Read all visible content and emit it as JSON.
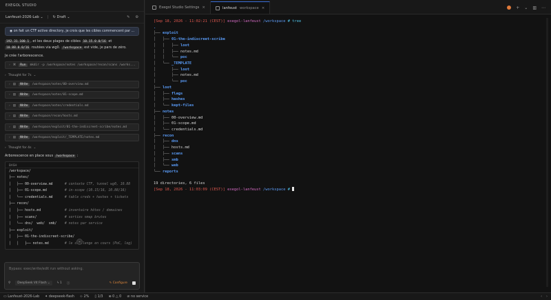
{
  "app": {
    "title": "EXEGOL STUDIO"
  },
  "session": {
    "name": "Lanfeust-2026-Lab",
    "status": "Draft"
  },
  "chat": {
    "user_message": "on fait un CTF active directory, je crois que les cibles commencent par ...",
    "para1_pre": "192.31.100.1",
    "para1_mid1": ", et les deux plages de cibles ",
    "para1_code2": "10.15.0.0/16",
    "para1_mid2": " et",
    "para1_code3": "10.88.0.0/16",
    "para1_mid3": " routées via wg0. ",
    "para1_code4": "/workspace",
    "para1_end": " est vide, je pars de zéro.",
    "para2": "Je crée l'arborescence.",
    "run_tool": {
      "verb": "Run",
      "path": "mkdir -p /workspace/notes /workspace/recon/scans /works..."
    },
    "thought1": "Thought for 7s",
    "writes": [
      "/workspace/notes/00-overview.md",
      "/workspace/notes/01-scope.md",
      "/workspace/notes/credentials.md",
      "/workspace/recon/hosts.md",
      "/workspace/exploit/01-the-indiscreet-scribe/notes.md",
      "/workspace/exploit/_TEMPLATE/notes.md"
    ],
    "write_verb": "Write",
    "thought2": "Thought for 4s",
    "para3_pre": "Arborescence en place sous ",
    "para3_code": "/workspace",
    "para3_end": " :",
    "bash_label": "BASH",
    "bash_lines": [
      {
        "t": "/workspace/",
        "c": ""
      },
      {
        "t": "├── notes/",
        "c": ""
      },
      {
        "t": "│   ├── 00-overview.md      ",
        "c": "# contexte CTF, tunnel wg0, 10.88"
      },
      {
        "t": "│   ├── 01-scope.md         ",
        "c": "# in-scope (10.15/16, 10.88/16)"
      },
      {
        "t": "│   └── credentials.md      ",
        "c": "# table creds + hashes + tickets"
      },
      {
        "t": "├── recon/",
        "c": ""
      },
      {
        "t": "│   ├── hosts.md            ",
        "c": "# inventaire hôtes / domaines"
      },
      {
        "t": "│   ├── scans/              ",
        "c": "# sorties nmap brutes"
      },
      {
        "t": "│   └── dns/  web/  smb/    ",
        "c": "# notes par service"
      },
      {
        "t": "├── exploit/",
        "c": ""
      },
      {
        "t": "│   ├── 01-the-indiscreet-scribe/",
        "c": ""
      },
      {
        "t": "│   │   ├── notes.md        ",
        "c": "# le challenge en cours (PoC, log)"
      }
    ]
  },
  "composer": {
    "placeholder": "Bypass: exec/write/edit run without asking.",
    "model": "DeepSeek V4 Flash",
    "count": "1",
    "configure": "Configure"
  },
  "tabs": [
    {
      "label": "Exegol Studio Settings",
      "active": false
    },
    {
      "label": "lanfeust",
      "sub": "workspace",
      "active": true
    }
  ],
  "terminal": {
    "prompt1_time": "[Sep 18, 2026 - 11:02:21 (CEST)]",
    "prompt_user": "exegol-lanfeust",
    "prompt_path": "/workspace",
    "prompt_cmd": "# tree",
    "tree": [
      {
        "p": "",
        "n": ".",
        "k": "blue"
      },
      {
        "p": "├── ",
        "n": "exploit",
        "k": "blueb"
      },
      {
        "p": "│   ├── ",
        "n": "01-the-indiscreet-scribe",
        "k": "blueb"
      },
      {
        "p": "│   │   ├── ",
        "n": "loot",
        "k": "blueb"
      },
      {
        "p": "│   │   ├── ",
        "n": "notes.md",
        "k": "file"
      },
      {
        "p": "│   │   └── ",
        "n": "poc",
        "k": "blueb"
      },
      {
        "p": "│   └── ",
        "n": "_TEMPLATE",
        "k": "blueb"
      },
      {
        "p": "│       ├── ",
        "n": "loot",
        "k": "blueb"
      },
      {
        "p": "│       ├── ",
        "n": "notes.md",
        "k": "file"
      },
      {
        "p": "│       └── ",
        "n": "poc",
        "k": "blueb"
      },
      {
        "p": "├── ",
        "n": "loot",
        "k": "blueb"
      },
      {
        "p": "│   ├── ",
        "n": "flags",
        "k": "blueb"
      },
      {
        "p": "│   ├── ",
        "n": "hashes",
        "k": "blueb"
      },
      {
        "p": "│   └── ",
        "n": "kept-files",
        "k": "blueb"
      },
      {
        "p": "├── ",
        "n": "notes",
        "k": "blueb"
      },
      {
        "p": "│   ├── ",
        "n": "00-overview.md",
        "k": "file"
      },
      {
        "p": "│   ├── ",
        "n": "01-scope.md",
        "k": "file"
      },
      {
        "p": "│   └── ",
        "n": "credentials.md",
        "k": "file"
      },
      {
        "p": "├── ",
        "n": "recon",
        "k": "blueb"
      },
      {
        "p": "│   ├── ",
        "n": "dns",
        "k": "blueb"
      },
      {
        "p": "│   ├── ",
        "n": "hosts.md",
        "k": "file"
      },
      {
        "p": "│   ├── ",
        "n": "scans",
        "k": "blueb"
      },
      {
        "p": "│   ├── ",
        "n": "smb",
        "k": "blueb"
      },
      {
        "p": "│   └── ",
        "n": "web",
        "k": "blueb"
      },
      {
        "p": "└── ",
        "n": "reports",
        "k": "blueb"
      }
    ],
    "summary": "19 directories, 6 files",
    "prompt2_time": "[Sep 18, 2026 - 11:03:09 (CEST)]",
    "prompt2_cmd": "#"
  },
  "statusbar": {
    "session": "Lanfeust-2026-Lab",
    "model": "deepseek-flash",
    "pct": "2%",
    "pages": "1/3",
    "errors": "0",
    "warnings": "0",
    "service": "no service"
  }
}
